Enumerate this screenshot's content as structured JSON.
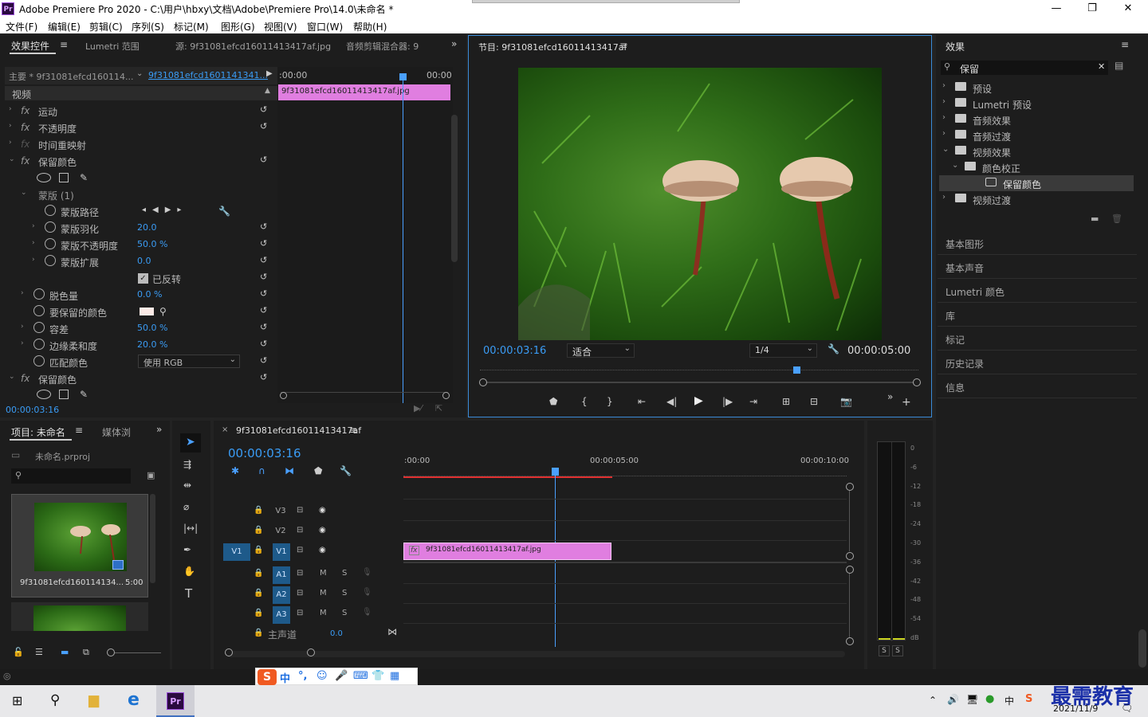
{
  "window": {
    "title": "Adobe Premiere Pro 2020 - C:\\用户\\hbxy\\文档\\Adobe\\Premiere Pro\\14.0\\未命名 *",
    "logo": "Pr"
  },
  "menu": [
    "文件(F)",
    "编辑(E)",
    "剪辑(C)",
    "序列(S)",
    "标记(M)",
    "图形(G)",
    "视图(V)",
    "窗口(W)",
    "帮助(H)"
  ],
  "effect_controls": {
    "tabs": [
      "效果控件",
      "Lumetri 范围",
      "源: 9f31081efcd16011413417af.jpg",
      "音频剪辑混合器: 9"
    ],
    "master_label": "主要 * 9f31081efcd160114...",
    "clip_select": "9f31081efcd1601141341...",
    "time_start": ":00:00",
    "time_end": "00:00",
    "clip_bar": "9f31081efcd16011413417af.jpg",
    "section_video": "视频",
    "rows": {
      "motion": "运动",
      "opacity": "不透明度",
      "time_remap": "时间重映射",
      "keep_color": "保留颜色",
      "mask": "蒙版 (1)",
      "mask_path": "蒙版路径",
      "mask_feather": "蒙版羽化",
      "mask_feather_val": "20.0",
      "mask_opacity": "蒙版不透明度",
      "mask_opacity_val": "50.0 %",
      "mask_expand": "蒙版扩展",
      "mask_expand_val": "0.0",
      "inverted": "已反转",
      "decolor": "脱色量",
      "decolor_val": "0.0 %",
      "color_to_keep": "要保留的颜色",
      "tolerance": "容差",
      "tolerance_val": "50.0 %",
      "edge_softness": "边缘柔和度",
      "edge_softness_val": "20.0 %",
      "match_colors": "匹配颜色",
      "match_colors_val": "使用 RGB",
      "keep_color2": "保留颜色"
    },
    "fx": "fx",
    "timecode": "00:00:03:16"
  },
  "program": {
    "title": "节目: 9f31081efcd16011413417af",
    "timecode": "00:00:03:16",
    "fit": "适合",
    "resolution": "1/4",
    "duration": "00:00:05:00"
  },
  "effects_panel": {
    "title": "效果",
    "search": "保留",
    "tree": [
      {
        "label": "预设",
        "level": 0,
        "icon": "preset"
      },
      {
        "label": "Lumetri 预设",
        "level": 0,
        "icon": "folder"
      },
      {
        "label": "音频效果",
        "level": 0,
        "icon": "folder"
      },
      {
        "label": "音频过渡",
        "level": 0,
        "icon": "folder"
      },
      {
        "label": "视频效果",
        "level": 0,
        "icon": "folder",
        "open": true
      },
      {
        "label": "颜色校正",
        "level": 1,
        "icon": "folder",
        "open": true
      },
      {
        "label": "保留颜色",
        "level": 2,
        "icon": "effect",
        "selected": true
      },
      {
        "label": "视频过渡",
        "level": 0,
        "icon": "folder"
      }
    ],
    "side_panels": [
      "基本图形",
      "基本声音",
      "Lumetri 颜色",
      "库",
      "标记",
      "历史记录",
      "信息"
    ]
  },
  "project": {
    "tabs": [
      "项目: 未命名",
      "媒体浏"
    ],
    "file": "未命名.prproj",
    "thumb_name": "9f31081efcd160114134...",
    "thumb_dur": "5:00"
  },
  "timeline": {
    "tab": "9f31081efcd16011413417af",
    "timecode": "00:00:03:16",
    "ruler": [
      ":00:00",
      "00:00:05:00",
      "00:00:10:00"
    ],
    "video_tracks": [
      "V3",
      "V2",
      "V1"
    ],
    "audio_tracks": [
      "A1",
      "A2",
      "A3"
    ],
    "source_v": "V1",
    "m": "M",
    "s": "S",
    "master": "主声道",
    "master_val": "0.0",
    "clip": "9f31081efcd16011413417af.jpg",
    "fx": "fx"
  },
  "meter": {
    "labels": [
      "0",
      "-6",
      "-12",
      "-18",
      "-24",
      "-30",
      "-36",
      "-42",
      "-48",
      "-54",
      "dB"
    ],
    "s": "S"
  },
  "ime": {
    "items": [
      "中",
      "°,",
      "☺",
      "🎤",
      "⌨",
      "👕",
      "▦"
    ]
  },
  "taskbar": {
    "date": "2021/11/9",
    "watermark": "最需教育",
    "ime": "中"
  },
  "colors": {
    "accent": "#3a9cf5",
    "clip": "#e07ee0",
    "playhead": "#4aa0ff"
  }
}
